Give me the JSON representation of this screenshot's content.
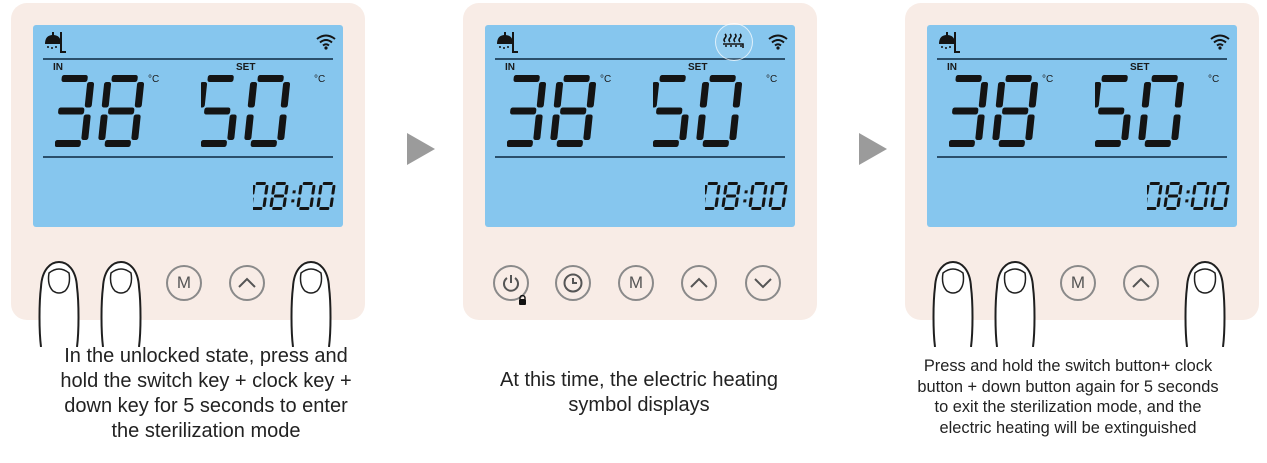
{
  "panels": [
    {
      "id": "p1",
      "readings": {
        "in_label": "IN",
        "in_value": "38",
        "set_label": "SET",
        "set_value": "50",
        "unit": "°C",
        "time": "08:00"
      },
      "buttons": {
        "mode_label": "M"
      },
      "heating_symbol_visible": false,
      "caption": [
        "In the unlocked state, press and",
        "hold the switch key + clock key +",
        "down key for 5 seconds to enter",
        "the sterilization mode"
      ]
    },
    {
      "id": "p2",
      "readings": {
        "in_label": "IN",
        "in_value": "38",
        "set_label": "SET",
        "set_value": "50",
        "unit": "°C",
        "time": "08:00"
      },
      "buttons": {
        "mode_label": "M"
      },
      "heating_symbol_visible": true,
      "caption": [
        "At this time, the electric heating",
        "symbol displays"
      ]
    },
    {
      "id": "p3",
      "readings": {
        "in_label": "IN",
        "in_value": "38",
        "set_label": "SET",
        "set_value": "50",
        "unit": "°C",
        "time": "08:00"
      },
      "buttons": {
        "mode_label": "M"
      },
      "heating_symbol_visible": false,
      "caption": [
        "Press and hold the switch button+ clock",
        "button + down button again for 5 seconds",
        "to exit the sterilization mode, and the",
        "electric heating will be extinguished"
      ]
    }
  ],
  "colors": {
    "panel": "#f8ece6",
    "lcd": "#86c6ee",
    "segment": "#141414",
    "arrow": "#9b9b9b"
  },
  "icons": [
    "shower-icon",
    "wifi-icon",
    "heating-icon",
    "power-icon",
    "clock-icon",
    "mode-icon",
    "up-icon",
    "down-icon",
    "lock-icon",
    "finger-icon",
    "next-arrow-icon"
  ]
}
